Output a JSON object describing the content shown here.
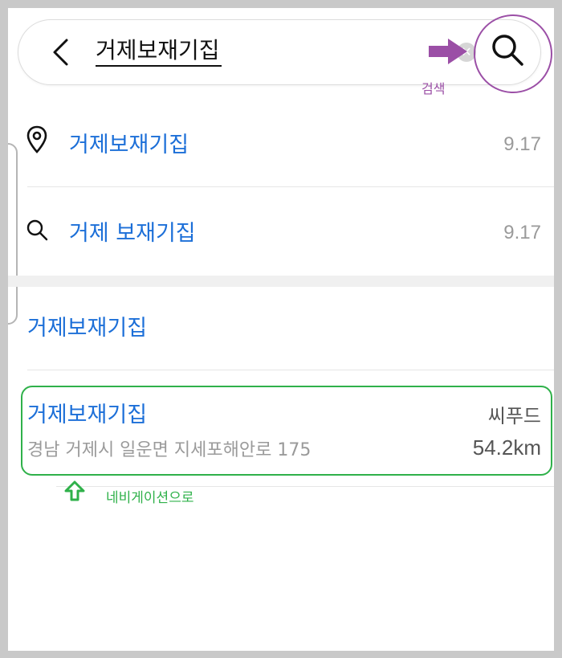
{
  "search": {
    "query": "거제보재기집",
    "annotation_label": "검색"
  },
  "suggestions": [
    {
      "type": "place",
      "icon": "location-pin-icon",
      "label": "거제보재기집",
      "date": "9.17"
    },
    {
      "type": "search",
      "icon": "search-icon",
      "label": "거제 보재기집",
      "date": "9.17"
    }
  ],
  "section_title": "거제보재기집",
  "result": {
    "name": "거제보재기집",
    "category": "씨푸드",
    "address": "경남 거제시 일운면 지세포해안로 175",
    "distance": "54.2km"
  },
  "annotations": {
    "navigation_label": "네비게이션으로",
    "search_color": "#9b4fa6",
    "navigation_color": "#2fb14a"
  },
  "colors": {
    "link": "#1c6fd8",
    "muted": "#9a9a9a"
  }
}
